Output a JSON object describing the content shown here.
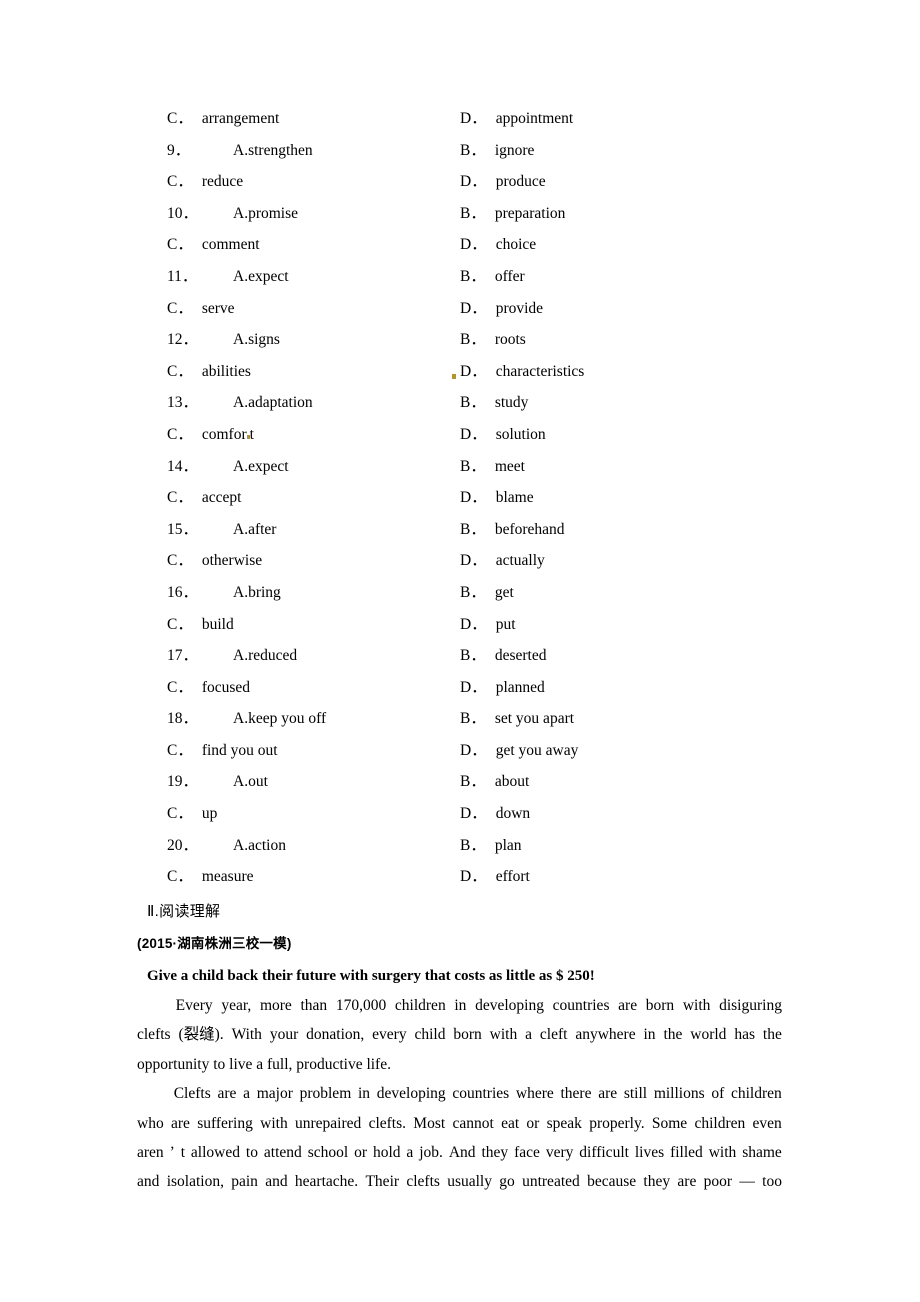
{
  "document": {
    "page_background": "#ffffff",
    "text_color": "#000000",
    "artifact_color": "#b5942e"
  },
  "cloze_options": {
    "rows": [
      {
        "left": {
          "num": "",
          "lead": "C．",
          "text": "arrangement"
        },
        "right": {
          "lead": "D．",
          "text": "appointment",
          "speck": false
        }
      },
      {
        "left": {
          "num": "9．",
          "lead": "A.",
          "text": "strengthen"
        },
        "right": {
          "lead": "B．",
          "text": "ignore",
          "speck": false
        }
      },
      {
        "left": {
          "num": "",
          "lead": "C．",
          "text": "reduce"
        },
        "right": {
          "lead": "D．",
          "text": "produce",
          "speck": false
        }
      },
      {
        "left": {
          "num": "10．",
          "lead": "A.",
          "text": "promise"
        },
        "right": {
          "lead": "B．",
          "text": "preparation",
          "speck": false
        }
      },
      {
        "left": {
          "num": "",
          "lead": "C．",
          "text": "comment"
        },
        "right": {
          "lead": "D．",
          "text": "choice",
          "speck": false
        }
      },
      {
        "left": {
          "num": "11．",
          "lead": "A.",
          "text": "expect"
        },
        "right": {
          "lead": "B．",
          "text": "offer",
          "speck": false
        }
      },
      {
        "left": {
          "num": "",
          "lead": "C．",
          "text": "serve"
        },
        "right": {
          "lead": "D．",
          "text": "provide",
          "speck": false
        }
      },
      {
        "left": {
          "num": "12．",
          "lead": "A.",
          "text": "signs"
        },
        "right": {
          "lead": "B．",
          "text": "roots",
          "speck": false
        }
      },
      {
        "left": {
          "num": "",
          "lead": "C．",
          "text": "abilities"
        },
        "right": {
          "lead": "D．",
          "text": "characteristics",
          "speck": true
        }
      },
      {
        "left": {
          "num": "13．",
          "lead": "A.",
          "text": "adaptation"
        },
        "right": {
          "lead": "B．",
          "text": "study",
          "speck": false
        }
      },
      {
        "left": {
          "num": "",
          "lead": "C．",
          "text": "comfor.t"
        },
        "right": {
          "lead": "D．",
          "text": "solution",
          "speck": false
        }
      },
      {
        "left": {
          "num": "14．",
          "lead": "A.",
          "text": "expect"
        },
        "right": {
          "lead": "B．",
          "text": "meet",
          "speck": false
        }
      },
      {
        "left": {
          "num": "",
          "lead": "C．",
          "text": "accept"
        },
        "right": {
          "lead": "D．",
          "text": "blame",
          "speck": false
        }
      },
      {
        "left": {
          "num": "15．",
          "lead": "A.",
          "text": "after"
        },
        "right": {
          "lead": "B．",
          "text": "beforehand",
          "speck": false
        }
      },
      {
        "left": {
          "num": "",
          "lead": "C．",
          "text": "otherwise"
        },
        "right": {
          "lead": "D．",
          "text": "actually",
          "speck": false
        }
      },
      {
        "left": {
          "num": "16．",
          "lead": "A.",
          "text": "bring"
        },
        "right": {
          "lead": "B．",
          "text": "get",
          "speck": false
        }
      },
      {
        "left": {
          "num": "",
          "lead": "C．",
          "text": "build"
        },
        "right": {
          "lead": "D．",
          "text": "put",
          "speck": false
        }
      },
      {
        "left": {
          "num": "17．",
          "lead": "A.",
          "text": "reduced"
        },
        "right": {
          "lead": "B．",
          "text": "deserted",
          "speck": false
        }
      },
      {
        "left": {
          "num": "",
          "lead": "C．",
          "text": "focused"
        },
        "right": {
          "lead": "D．",
          "text": "planned",
          "speck": false
        }
      },
      {
        "left": {
          "num": "18．",
          "lead": "A.",
          "text": "keep you off"
        },
        "right": {
          "lead": "B．",
          "text": "set you apart",
          "speck": false
        }
      },
      {
        "left": {
          "num": "",
          "lead": "C．",
          "text": "find you out"
        },
        "right": {
          "lead": "D．",
          "text": "get you away",
          "speck": false
        }
      },
      {
        "left": {
          "num": "19．",
          "lead": "A.",
          "text": "out"
        },
        "right": {
          "lead": "B．",
          "text": "about",
          "speck": false
        }
      },
      {
        "left": {
          "num": "",
          "lead": "C．",
          "text": "up"
        },
        "right": {
          "lead": "D．",
          "text": "down",
          "speck": false
        }
      },
      {
        "left": {
          "num": "20．",
          "lead": "A.",
          "text": "action"
        },
        "right": {
          "lead": "B．",
          "text": "plan",
          "speck": false
        }
      },
      {
        "left": {
          "num": "",
          "lead": "C．",
          "text": "measure"
        },
        "right": {
          "lead": "D．",
          "text": "effort",
          "speck": false
        }
      }
    ]
  },
  "section": {
    "heading": "Ⅱ.阅读理解",
    "source": "(2015·湖南株洲三校一模)"
  },
  "passage": {
    "title": "Give a child back their future with surgery that costs as little as $ 250!",
    "paragraph1_lines": [
      [
        "Every",
        "year,",
        "more",
        "than",
        "170,000",
        "children",
        "in",
        "developing",
        "countries",
        "are",
        "born",
        "with",
        "disiguring"
      ],
      [
        "clefts",
        "(裂缝).",
        "With",
        "your",
        "donation,",
        "every",
        "child",
        "born",
        "with",
        "a",
        "cleft",
        "anywhere",
        "in",
        "the",
        "world",
        "has",
        "the"
      ],
      [
        "opportunity to live a full, productive life."
      ]
    ],
    "paragraph2_lines": [
      [
        "Clefts",
        "are",
        "a",
        "major",
        "problem",
        "in",
        "developing",
        "countries",
        "where",
        "there",
        "are",
        "still",
        "millions",
        "of",
        "children"
      ],
      [
        "who",
        "are",
        "suffering",
        "with",
        "unrepaired",
        "clefts.",
        "Most",
        "cannot",
        "eat",
        "or",
        "speak",
        "properly.",
        "Some",
        "children",
        "even"
      ],
      [
        "aren",
        "’",
        "t",
        "allowed",
        "to",
        "attend",
        "school",
        "or",
        "hold",
        "a",
        "job.",
        "And",
        "they",
        "face",
        "very",
        "difficult",
        "lives",
        "filled",
        "with",
        "shame"
      ],
      [
        "and",
        "isolation,",
        "pain",
        "and",
        "heartache.",
        "Their",
        "clefts",
        "usually",
        "go",
        "untreated",
        "because",
        "they",
        "are",
        "poor",
        "—",
        "too"
      ]
    ]
  }
}
